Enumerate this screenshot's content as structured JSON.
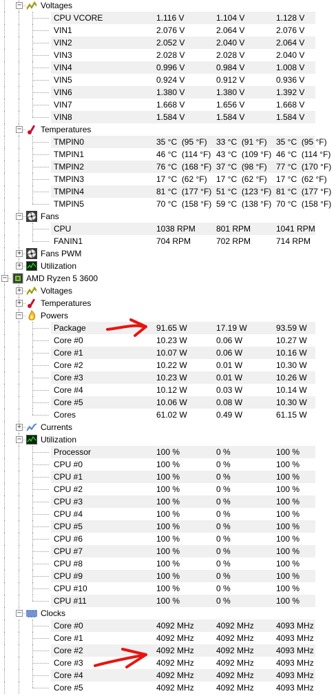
{
  "colors": {
    "alt_row": "#f0f0f0",
    "tree_line": "#9a9a9a",
    "annotation_arrow": "#e8140f"
  },
  "rows": [
    {
      "type": "group",
      "indent": 1,
      "expanded": true,
      "icon": "voltage-icon",
      "label": "Voltages"
    },
    {
      "type": "leaf",
      "indent": 2,
      "label": "CPU VCORE",
      "v": [
        "1.116 V",
        "1.104 V",
        "1.128 V"
      ]
    },
    {
      "type": "leaf",
      "indent": 2,
      "label": "VIN1",
      "v": [
        "2.076 V",
        "2.064 V",
        "2.076 V"
      ]
    },
    {
      "type": "leaf",
      "indent": 2,
      "label": "VIN2",
      "v": [
        "2.052 V",
        "2.040 V",
        "2.064 V"
      ]
    },
    {
      "type": "leaf",
      "indent": 2,
      "label": "VIN3",
      "v": [
        "2.028 V",
        "2.028 V",
        "2.040 V"
      ]
    },
    {
      "type": "leaf",
      "indent": 2,
      "label": "VIN4",
      "v": [
        "0.996 V",
        "0.984 V",
        "1.008 V"
      ]
    },
    {
      "type": "leaf",
      "indent": 2,
      "label": "VIN5",
      "v": [
        "0.924 V",
        "0.912 V",
        "0.936 V"
      ]
    },
    {
      "type": "leaf",
      "indent": 2,
      "label": "VIN6",
      "v": [
        "1.380 V",
        "1.380 V",
        "1.392 V"
      ]
    },
    {
      "type": "leaf",
      "indent": 2,
      "label": "VIN7",
      "v": [
        "1.668 V",
        "1.656 V",
        "1.668 V"
      ]
    },
    {
      "type": "leaf",
      "indent": 2,
      "label": "VIN8",
      "v": [
        "1.584 V",
        "1.584 V",
        "1.584 V"
      ]
    },
    {
      "type": "group",
      "indent": 1,
      "expanded": true,
      "icon": "thermometer-icon",
      "label": "Temperatures"
    },
    {
      "type": "leaf",
      "indent": 2,
      "label": "TMPIN0",
      "v": [
        "35 °C  (95 °F)",
        "33 °C  (91 °F)",
        "35 °C  (95 °F)"
      ]
    },
    {
      "type": "leaf",
      "indent": 2,
      "label": "TMPIN1",
      "v": [
        "46 °C  (114 °F)",
        "43 °C  (109 °F)",
        "46 °C  (114 °F)"
      ]
    },
    {
      "type": "leaf",
      "indent": 2,
      "label": "TMPIN2",
      "v": [
        "76 °C  (168 °F)",
        "37 °C  (98 °F)",
        "77 °C  (170 °F)"
      ]
    },
    {
      "type": "leaf",
      "indent": 2,
      "label": "TMPIN3",
      "v": [
        "17 °C  (62 °F)",
        "17 °C  (62 °F)",
        "17 °C  (62 °F)"
      ]
    },
    {
      "type": "leaf",
      "indent": 2,
      "label": "TMPIN4",
      "v": [
        "81 °C  (177 °F)",
        "51 °C  (123 °F)",
        "81 °C  (177 °F)"
      ]
    },
    {
      "type": "leaf",
      "indent": 2,
      "label": "TMPIN5",
      "v": [
        "70 °C  (158 °F)",
        "59 °C  (138 °F)",
        "70 °C  (158 °F)"
      ]
    },
    {
      "type": "group",
      "indent": 1,
      "expanded": true,
      "icon": "fan-icon",
      "label": "Fans"
    },
    {
      "type": "leaf",
      "indent": 2,
      "label": "CPU",
      "v": [
        "1038 RPM",
        "801 RPM",
        "1041 RPM"
      ]
    },
    {
      "type": "leaf",
      "indent": 2,
      "label": "FANIN1",
      "v": [
        "704 RPM",
        "702 RPM",
        "714 RPM"
      ]
    },
    {
      "type": "group",
      "indent": 1,
      "expanded": false,
      "icon": "fan-icon",
      "label": "Fans PWM"
    },
    {
      "type": "group",
      "indent": 1,
      "expanded": false,
      "icon": "utilization-icon",
      "label": "Utilization"
    },
    {
      "type": "group",
      "indent": 0,
      "expanded": true,
      "icon": "cpu-chip-icon",
      "label": "AMD Ryzen 5 3600"
    },
    {
      "type": "group",
      "indent": 1,
      "expanded": false,
      "icon": "voltage-icon",
      "label": "Voltages"
    },
    {
      "type": "group",
      "indent": 1,
      "expanded": false,
      "icon": "thermometer-icon",
      "label": "Temperatures"
    },
    {
      "type": "group",
      "indent": 1,
      "expanded": true,
      "icon": "power-flame-icon",
      "label": "Powers"
    },
    {
      "type": "leaf",
      "indent": 2,
      "label": "Package",
      "v": [
        "91.65 W",
        "17.19 W",
        "93.59 W"
      ]
    },
    {
      "type": "leaf",
      "indent": 2,
      "label": "Core #0",
      "v": [
        "10.23 W",
        "0.06 W",
        "10.27 W"
      ]
    },
    {
      "type": "leaf",
      "indent": 2,
      "label": "Core #1",
      "v": [
        "10.07 W",
        "0.06 W",
        "10.16 W"
      ]
    },
    {
      "type": "leaf",
      "indent": 2,
      "label": "Core #2",
      "v": [
        "10.22 W",
        "0.01 W",
        "10.30 W"
      ]
    },
    {
      "type": "leaf",
      "indent": 2,
      "label": "Core #3",
      "v": [
        "10.23 W",
        "0.01 W",
        "10.26 W"
      ]
    },
    {
      "type": "leaf",
      "indent": 2,
      "label": "Core #4",
      "v": [
        "10.12 W",
        "0.03 W",
        "10.14 W"
      ]
    },
    {
      "type": "leaf",
      "indent": 2,
      "label": "Core #5",
      "v": [
        "10.06 W",
        "0.08 W",
        "10.30 W"
      ]
    },
    {
      "type": "leaf",
      "indent": 2,
      "label": "Cores",
      "v": [
        "61.02 W",
        "0.49 W",
        "61.15 W"
      ]
    },
    {
      "type": "group",
      "indent": 1,
      "expanded": false,
      "icon": "current-icon",
      "label": "Currents"
    },
    {
      "type": "group",
      "indent": 1,
      "expanded": true,
      "icon": "utilization-icon",
      "label": "Utilization"
    },
    {
      "type": "leaf",
      "indent": 2,
      "label": "Processor",
      "v": [
        "100 %",
        "0 %",
        "100 %"
      ]
    },
    {
      "type": "leaf",
      "indent": 2,
      "label": "CPU #0",
      "v": [
        "100 %",
        "0 %",
        "100 %"
      ]
    },
    {
      "type": "leaf",
      "indent": 2,
      "label": "CPU #1",
      "v": [
        "100 %",
        "0 %",
        "100 %"
      ]
    },
    {
      "type": "leaf",
      "indent": 2,
      "label": "CPU #2",
      "v": [
        "100 %",
        "0 %",
        "100 %"
      ]
    },
    {
      "type": "leaf",
      "indent": 2,
      "label": "CPU #3",
      "v": [
        "100 %",
        "0 %",
        "100 %"
      ]
    },
    {
      "type": "leaf",
      "indent": 2,
      "label": "CPU #4",
      "v": [
        "100 %",
        "0 %",
        "100 %"
      ]
    },
    {
      "type": "leaf",
      "indent": 2,
      "label": "CPU #5",
      "v": [
        "100 %",
        "0 %",
        "100 %"
      ]
    },
    {
      "type": "leaf",
      "indent": 2,
      "label": "CPU #6",
      "v": [
        "100 %",
        "0 %",
        "100 %"
      ]
    },
    {
      "type": "leaf",
      "indent": 2,
      "label": "CPU #7",
      "v": [
        "100 %",
        "0 %",
        "100 %"
      ]
    },
    {
      "type": "leaf",
      "indent": 2,
      "label": "CPU #8",
      "v": [
        "100 %",
        "0 %",
        "100 %"
      ]
    },
    {
      "type": "leaf",
      "indent": 2,
      "label": "CPU #9",
      "v": [
        "100 %",
        "0 %",
        "100 %"
      ]
    },
    {
      "type": "leaf",
      "indent": 2,
      "label": "CPU #10",
      "v": [
        "100 %",
        "0 %",
        "100 %"
      ]
    },
    {
      "type": "leaf",
      "indent": 2,
      "label": "CPU #11",
      "v": [
        "100 %",
        "0 %",
        "100 %"
      ]
    },
    {
      "type": "group",
      "indent": 1,
      "expanded": true,
      "icon": "clock-icon",
      "label": "Clocks"
    },
    {
      "type": "leaf",
      "indent": 2,
      "label": "Core #0",
      "v": [
        "4092 MHz",
        "4092 MHz",
        "4093 MHz"
      ]
    },
    {
      "type": "leaf",
      "indent": 2,
      "label": "Core #1",
      "v": [
        "4092 MHz",
        "4092 MHz",
        "4093 MHz"
      ]
    },
    {
      "type": "leaf",
      "indent": 2,
      "label": "Core #2",
      "v": [
        "4092 MHz",
        "4092 MHz",
        "4093 MHz"
      ]
    },
    {
      "type": "leaf",
      "indent": 2,
      "label": "Core #3",
      "v": [
        "4092 MHz",
        "4092 MHz",
        "4093 MHz"
      ]
    },
    {
      "type": "leaf",
      "indent": 2,
      "label": "Core #4",
      "v": [
        "4092 MHz",
        "4092 MHz",
        "4093 MHz"
      ]
    },
    {
      "type": "leaf",
      "indent": 2,
      "label": "Core #5",
      "v": [
        "4092 MHz",
        "4092 MHz",
        "4093 MHz"
      ]
    }
  ]
}
